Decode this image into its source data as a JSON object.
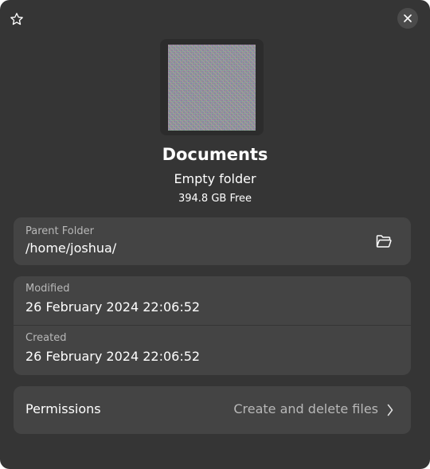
{
  "header": {
    "star_icon": "star-outline-icon",
    "close_icon": "close-icon"
  },
  "folder": {
    "name": "Documents",
    "description": "Empty folder",
    "free_space": "394.8 GB Free"
  },
  "parent": {
    "label": "Parent Folder",
    "path": "/home/joshua/",
    "open_icon": "folder-open-icon"
  },
  "dates": {
    "modified_label": "Modified",
    "modified_value": "26 February 2024 22:06:52",
    "created_label": "Created",
    "created_value": "26 February 2024 22:06:52"
  },
  "permissions": {
    "label": "Permissions",
    "value": "Create and delete files",
    "chevron_icon": "chevron-right-icon"
  },
  "colors": {
    "window_bg": "#353535",
    "card_bg": "#444444",
    "text_primary": "#ffffff",
    "text_secondary": "#b8b8b8"
  }
}
